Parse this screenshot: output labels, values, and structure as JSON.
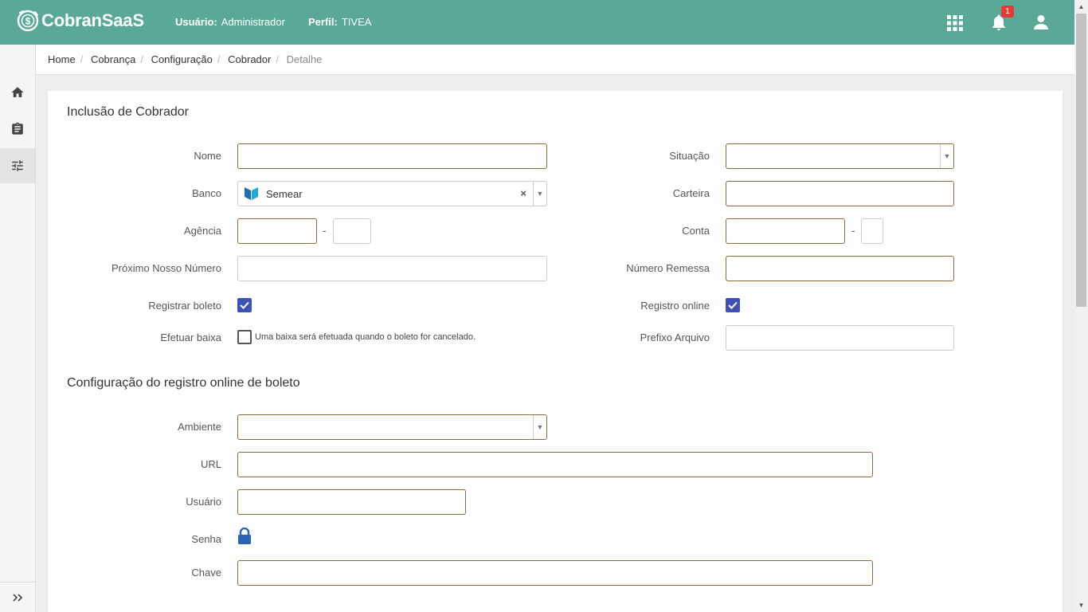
{
  "app": {
    "name": "CobranSaaS"
  },
  "header": {
    "user_label": "Usuário:",
    "user_value": "Administrador",
    "profile_label": "Perfil:",
    "profile_value": "TIVEA",
    "notification_count": "1",
    "accent_color": "#5aa898"
  },
  "sidebar": {
    "items": [
      {
        "name": "home",
        "icon": "home-icon"
      },
      {
        "name": "clipboard",
        "icon": "clipboard-icon"
      },
      {
        "name": "settings",
        "icon": "sliders-icon",
        "active": true
      }
    ],
    "expand_icon": "double-chevron-right-icon"
  },
  "breadcrumb": {
    "items": [
      "Home",
      "Cobrança",
      "Configuração",
      "Cobrador"
    ],
    "current": "Detalhe"
  },
  "form": {
    "title": "Inclusão de Cobrador",
    "nome": {
      "label": "Nome",
      "value": ""
    },
    "situacao": {
      "label": "Situação",
      "value": ""
    },
    "banco": {
      "label": "Banco",
      "value": "Semear"
    },
    "carteira": {
      "label": "Carteira",
      "value": ""
    },
    "agencia": {
      "label": "Agência",
      "value": "",
      "digit": ""
    },
    "conta": {
      "label": "Conta",
      "value": "",
      "digit": ""
    },
    "proximo_nosso_numero": {
      "label": "Próximo Nosso Número",
      "value": ""
    },
    "numero_remessa": {
      "label": "Número Remessa",
      "value": ""
    },
    "registrar_boleto": {
      "label": "Registrar boleto",
      "checked": true
    },
    "registro_online": {
      "label": "Registro online",
      "checked": true
    },
    "efetuar_baixa": {
      "label": "Efetuar baixa",
      "checked": false,
      "hint": "Uma baixa será efetuada quando o boleto for cancelado."
    },
    "prefixo_arquivo": {
      "label": "Prefixo Arquivo",
      "value": ""
    },
    "separator": "-"
  },
  "online_config": {
    "title": "Configuração do registro online de boleto",
    "ambiente": {
      "label": "Ambiente",
      "value": ""
    },
    "url": {
      "label": "URL",
      "value": ""
    },
    "usuario": {
      "label": "Usuário",
      "value": ""
    },
    "senha": {
      "label": "Senha",
      "icon": "lock-icon"
    },
    "chave": {
      "label": "Chave",
      "value": ""
    }
  },
  "colors": {
    "checkbox": "#3f51b5",
    "input_border": "#8b6b3d"
  }
}
